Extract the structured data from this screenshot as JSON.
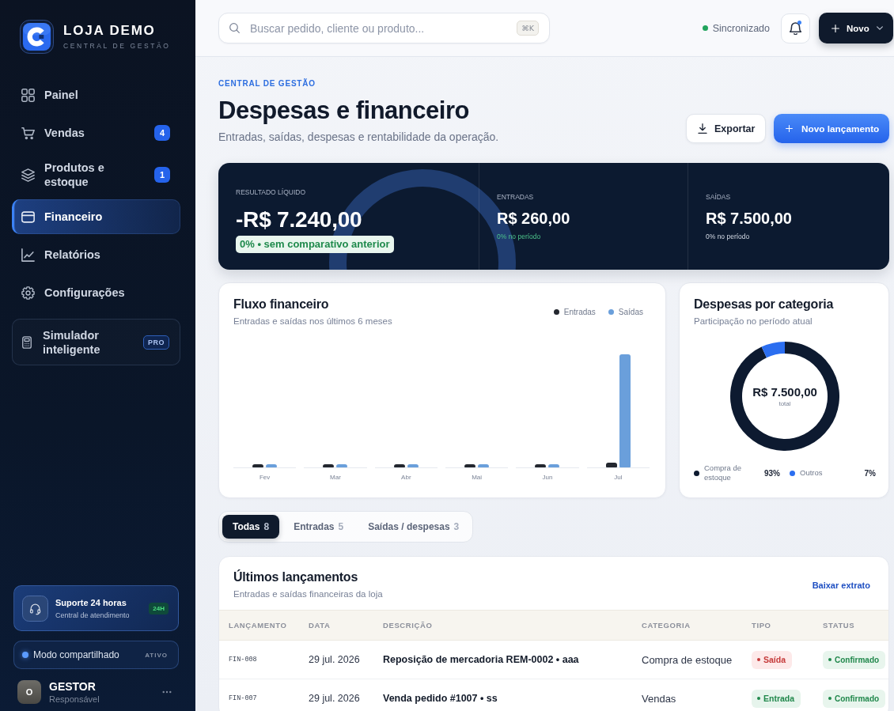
{
  "sidebar": {
    "brand": {
      "name": "LOJA DEMO",
      "tagline": "CENTRAL DE GESTÃO"
    },
    "nav": [
      {
        "label": "Painel",
        "selected": false
      },
      {
        "label": "Vendas",
        "badge": "4",
        "selected": false
      },
      {
        "label": "Produtos e estoque",
        "badge": "1",
        "selected": false
      },
      {
        "label": "Financeiro",
        "selected": true
      },
      {
        "label": "Relatórios",
        "selected": false
      },
      {
        "label": "Configurações",
        "selected": false
      }
    ],
    "promo": {
      "label": "Simulador inteligente",
      "badge": "PRO"
    },
    "support": {
      "title": "Suporte 24 horas",
      "subtitle": "Central de atendimento",
      "badge": "24H"
    },
    "mode": {
      "label": "Modo compartilhado",
      "status": "ATIVO",
      "on": true
    },
    "user": {
      "initial": "O",
      "name": "GESTOR",
      "role": "Responsável"
    }
  },
  "topbar": {
    "search": {
      "placeholder": "Buscar pedido, cliente ou produto...",
      "shortcut": "⌘K"
    },
    "sync": {
      "label": "Sincronizado",
      "synced": true
    },
    "notifications": {
      "unread": true
    },
    "new_button": {
      "label": "Novo"
    }
  },
  "page": {
    "eyebrow": "CENTRAL DE GESTÃO",
    "title": "Despesas e financeiro",
    "subtitle": "Entradas, saídas, despesas e rentabilidade da operação.",
    "actions": [
      {
        "label": "Exportar",
        "kind": "secondary"
      },
      {
        "label": "Novo lançamento",
        "kind": "primary"
      }
    ]
  },
  "summary": [
    {
      "kind": "main",
      "label": "RESULTADO LÍQUIDO",
      "value": "-R$ 7.240,00",
      "note": "0% • sem comparativo anterior"
    },
    {
      "kind": "income",
      "label": "ENTRADAS",
      "value": "R$ 260,00",
      "note": "0% no período"
    },
    {
      "kind": "expense",
      "label": "SAÍDAS",
      "value": "R$ 7.500,00",
      "note": "0% no período"
    }
  ],
  "flow_chart": {
    "title": "Fluxo financeiro",
    "subtitle": "Entradas e saídas nos últimos 6 meses",
    "legend": [
      {
        "label": "Entradas",
        "color": "#23272f"
      },
      {
        "label": "Saídas",
        "color": "#6a9fdb"
      }
    ],
    "months": [
      "Fev",
      "Mar",
      "Abr",
      "Mai",
      "Jun",
      "Jul"
    ]
  },
  "expenses_by_category": {
    "title": "Despesas por categoria",
    "subtitle": "Participação no período atual",
    "total": "R$ 7.500,00",
    "total_label": "total",
    "chart_data": {
      "type": "donut",
      "categories": [
        "Compra de estoque",
        "Outros"
      ],
      "values": [
        93,
        7
      ]
    },
    "legend": [
      {
        "share": "93%",
        "color": "#0d1a30"
      },
      {
        "share": "7%",
        "color": "#2b6ef0"
      }
    ]
  },
  "tabs": [
    {
      "label": "Todas",
      "count": "8",
      "selected": true
    },
    {
      "label": "Entradas",
      "count": "5",
      "selected": false
    },
    {
      "label": "Saídas / despesas",
      "count": "3",
      "selected": false
    }
  ],
  "entries": {
    "title": "Últimos lançamentos",
    "subtitle": "Entradas e saídas financeiras da loja",
    "link": "Baixar extrato",
    "columns": [
      "LANÇAMENTO",
      "DATA",
      "DESCRIÇÃO",
      "CATEGORIA",
      "TIPO",
      "STATUS"
    ],
    "rows": [
      {
        "id": "FIN-008",
        "date": "29 jul. 2026",
        "description": "Reposição de mercadoria REM-0002 • aaa",
        "category": "Compra de estoque",
        "type": {
          "label": "Saída",
          "kind": "expense"
        },
        "status": {
          "label": "Confirmado",
          "kind": "confirmed"
        }
      },
      {
        "id": "FIN-007",
        "date": "29 jul. 2026",
        "description": "Venda pedido #1007 • ss",
        "category": "Vendas",
        "type": {
          "label": "Entrada",
          "kind": "income"
        },
        "status": {
          "label": "Confirmado",
          "kind": "confirmed"
        }
      }
    ]
  }
}
